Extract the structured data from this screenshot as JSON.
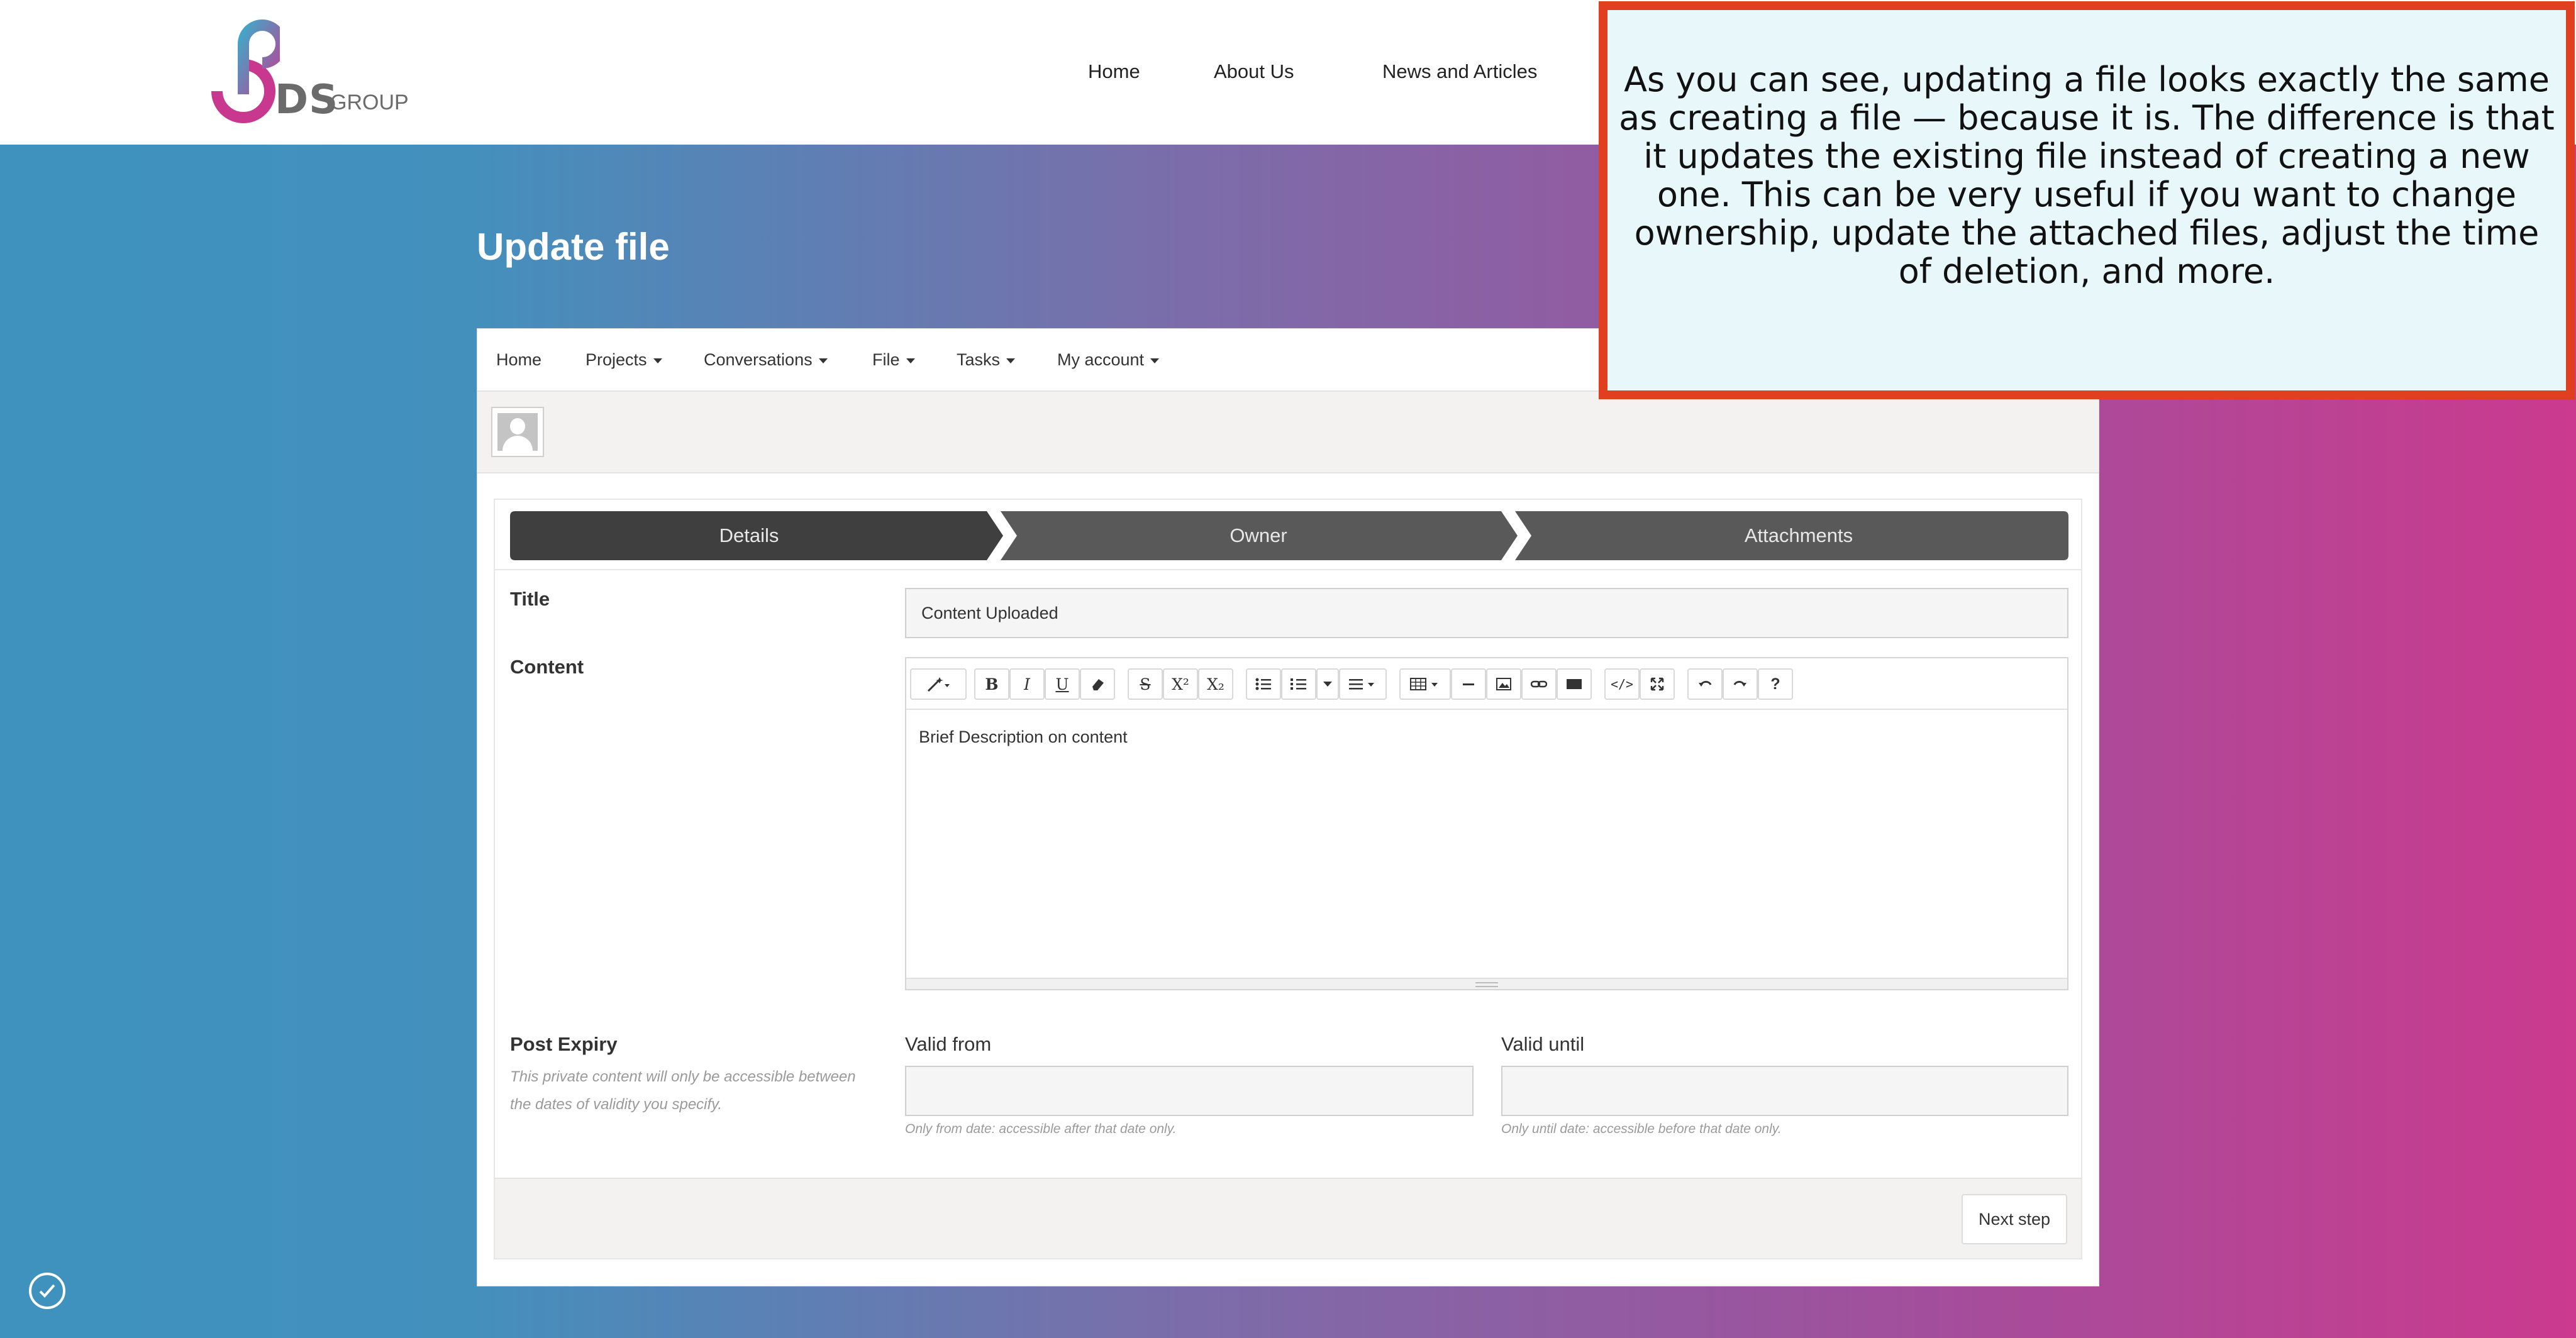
{
  "brand": {
    "logo_mark": "DS",
    "logo_group": "GROUP"
  },
  "main_nav": {
    "items": [
      "Home",
      "About Us",
      "News and Articles"
    ]
  },
  "page": {
    "title": "Update file"
  },
  "app_nav": {
    "items": [
      "Home",
      "Projects",
      "Conversations",
      "File",
      "Tasks",
      "My account"
    ]
  },
  "wizard": {
    "steps": [
      "Details",
      "Owner",
      "Attachments"
    ],
    "active_step": "Details"
  },
  "form": {
    "title_label": "Title",
    "title_value": "Content Uploaded",
    "content_label": "Content",
    "content_value": "Brief Description on content",
    "post_expiry_label": "Post Expiry",
    "post_expiry_hint": "This private content will only be accessible between the dates of validity you specify.",
    "valid_from_label": "Valid from",
    "valid_from_value": "",
    "valid_from_hint": "Only from date: accessible after that date only.",
    "valid_until_label": "Valid until",
    "valid_until_value": "",
    "valid_until_hint": "Only until date: accessible before that date only.",
    "next_button": "Next step"
  },
  "editor_toolbar": {
    "buttons": [
      "magic-wand-icon",
      "bold-icon",
      "italic-icon",
      "underline-icon",
      "eraser-icon",
      "strikethrough-icon",
      "superscript-icon",
      "subscript-icon",
      "unordered-list-icon",
      "ordered-list-icon",
      "align-icon",
      "table-icon",
      "horizontal-rule-icon",
      "image-icon",
      "link-icon",
      "video-icon",
      "code-view-icon",
      "fullscreen-icon",
      "undo-icon",
      "redo-icon",
      "help-icon"
    ],
    "glyphs": {
      "bold": "B",
      "italic": "I",
      "underline": "U",
      "strike": "S",
      "super": "X²",
      "sub": "X₂",
      "help": "?"
    }
  },
  "callout": {
    "text": "As you can see, updating a file looks exactly the same as creating a file — because it is. The difference is that it updates the existing file instead of creating a new one. This can be very useful if you want to change ownership, update the attached files, adjust the time of deletion, and more."
  },
  "colors": {
    "gradient_left": "#3f92be",
    "gradient_right": "#cb3a8e",
    "wizard_active": "#3f3f3f",
    "wizard_inactive": "#595959",
    "callout_border": "#e0401f",
    "callout_bg": "#e8f8fa"
  }
}
